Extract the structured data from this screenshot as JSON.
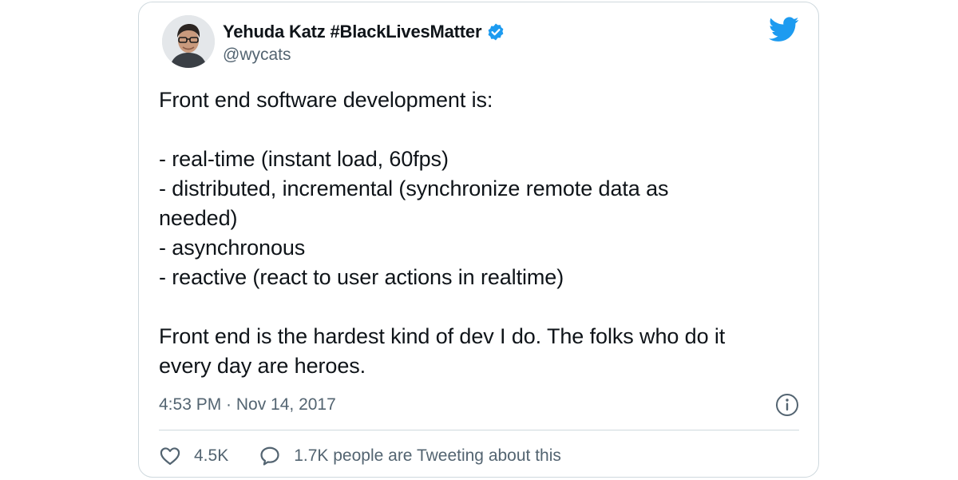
{
  "author": {
    "display_name": "Yehuda Katz #BlackLivesMatter",
    "handle": "@wycats",
    "verified": true
  },
  "tweet": {
    "text": "Front end software development is:\n\n- real-time (instant load, 60fps)\n- distributed, incremental (synchronize remote data as\nneeded)\n- asynchronous\n- reactive (react to user actions in realtime)\n\nFront end is the hardest kind of dev I do. The folks who do it\nevery day are heroes.",
    "timestamp": "4:53 PM · Nov 14, 2017"
  },
  "actions": {
    "likes": "4.5K",
    "conversation": "1.7K people are Tweeting about this"
  },
  "icons": {
    "brand": "twitter-bird-icon",
    "verified": "verified-badge-icon",
    "info": "info-icon",
    "like": "heart-icon",
    "reply": "speech-bubble-icon"
  },
  "colors": {
    "brand": "#1d9bf0",
    "text": "#0f1419",
    "secondary": "#536471",
    "border": "#cfd9de"
  }
}
